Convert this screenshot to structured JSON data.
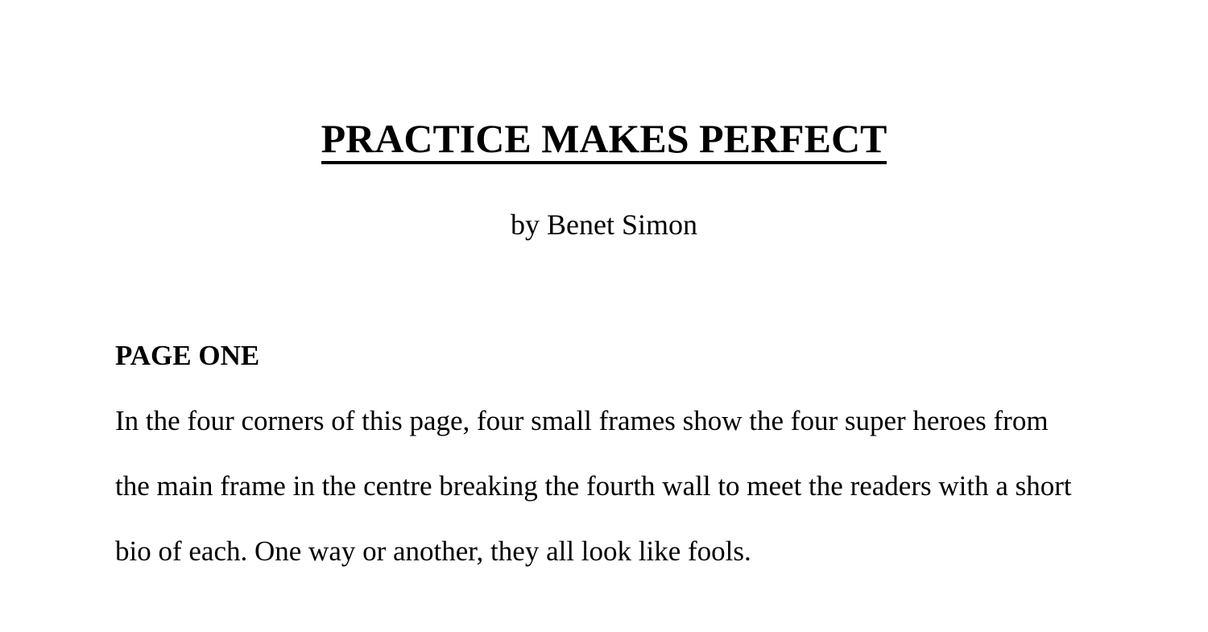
{
  "document": {
    "title": "PRACTICE MAKES PERFECT",
    "byline": "by Benet Simon",
    "section_heading": "PAGE ONE",
    "paragraph_lines": [
      "In the four corners of this page, four small frames show the four super heroes from",
      "the main frame in the centre breaking the fourth wall to meet the readers with a short",
      "bio of each. One way or another, they all look like fools."
    ]
  }
}
